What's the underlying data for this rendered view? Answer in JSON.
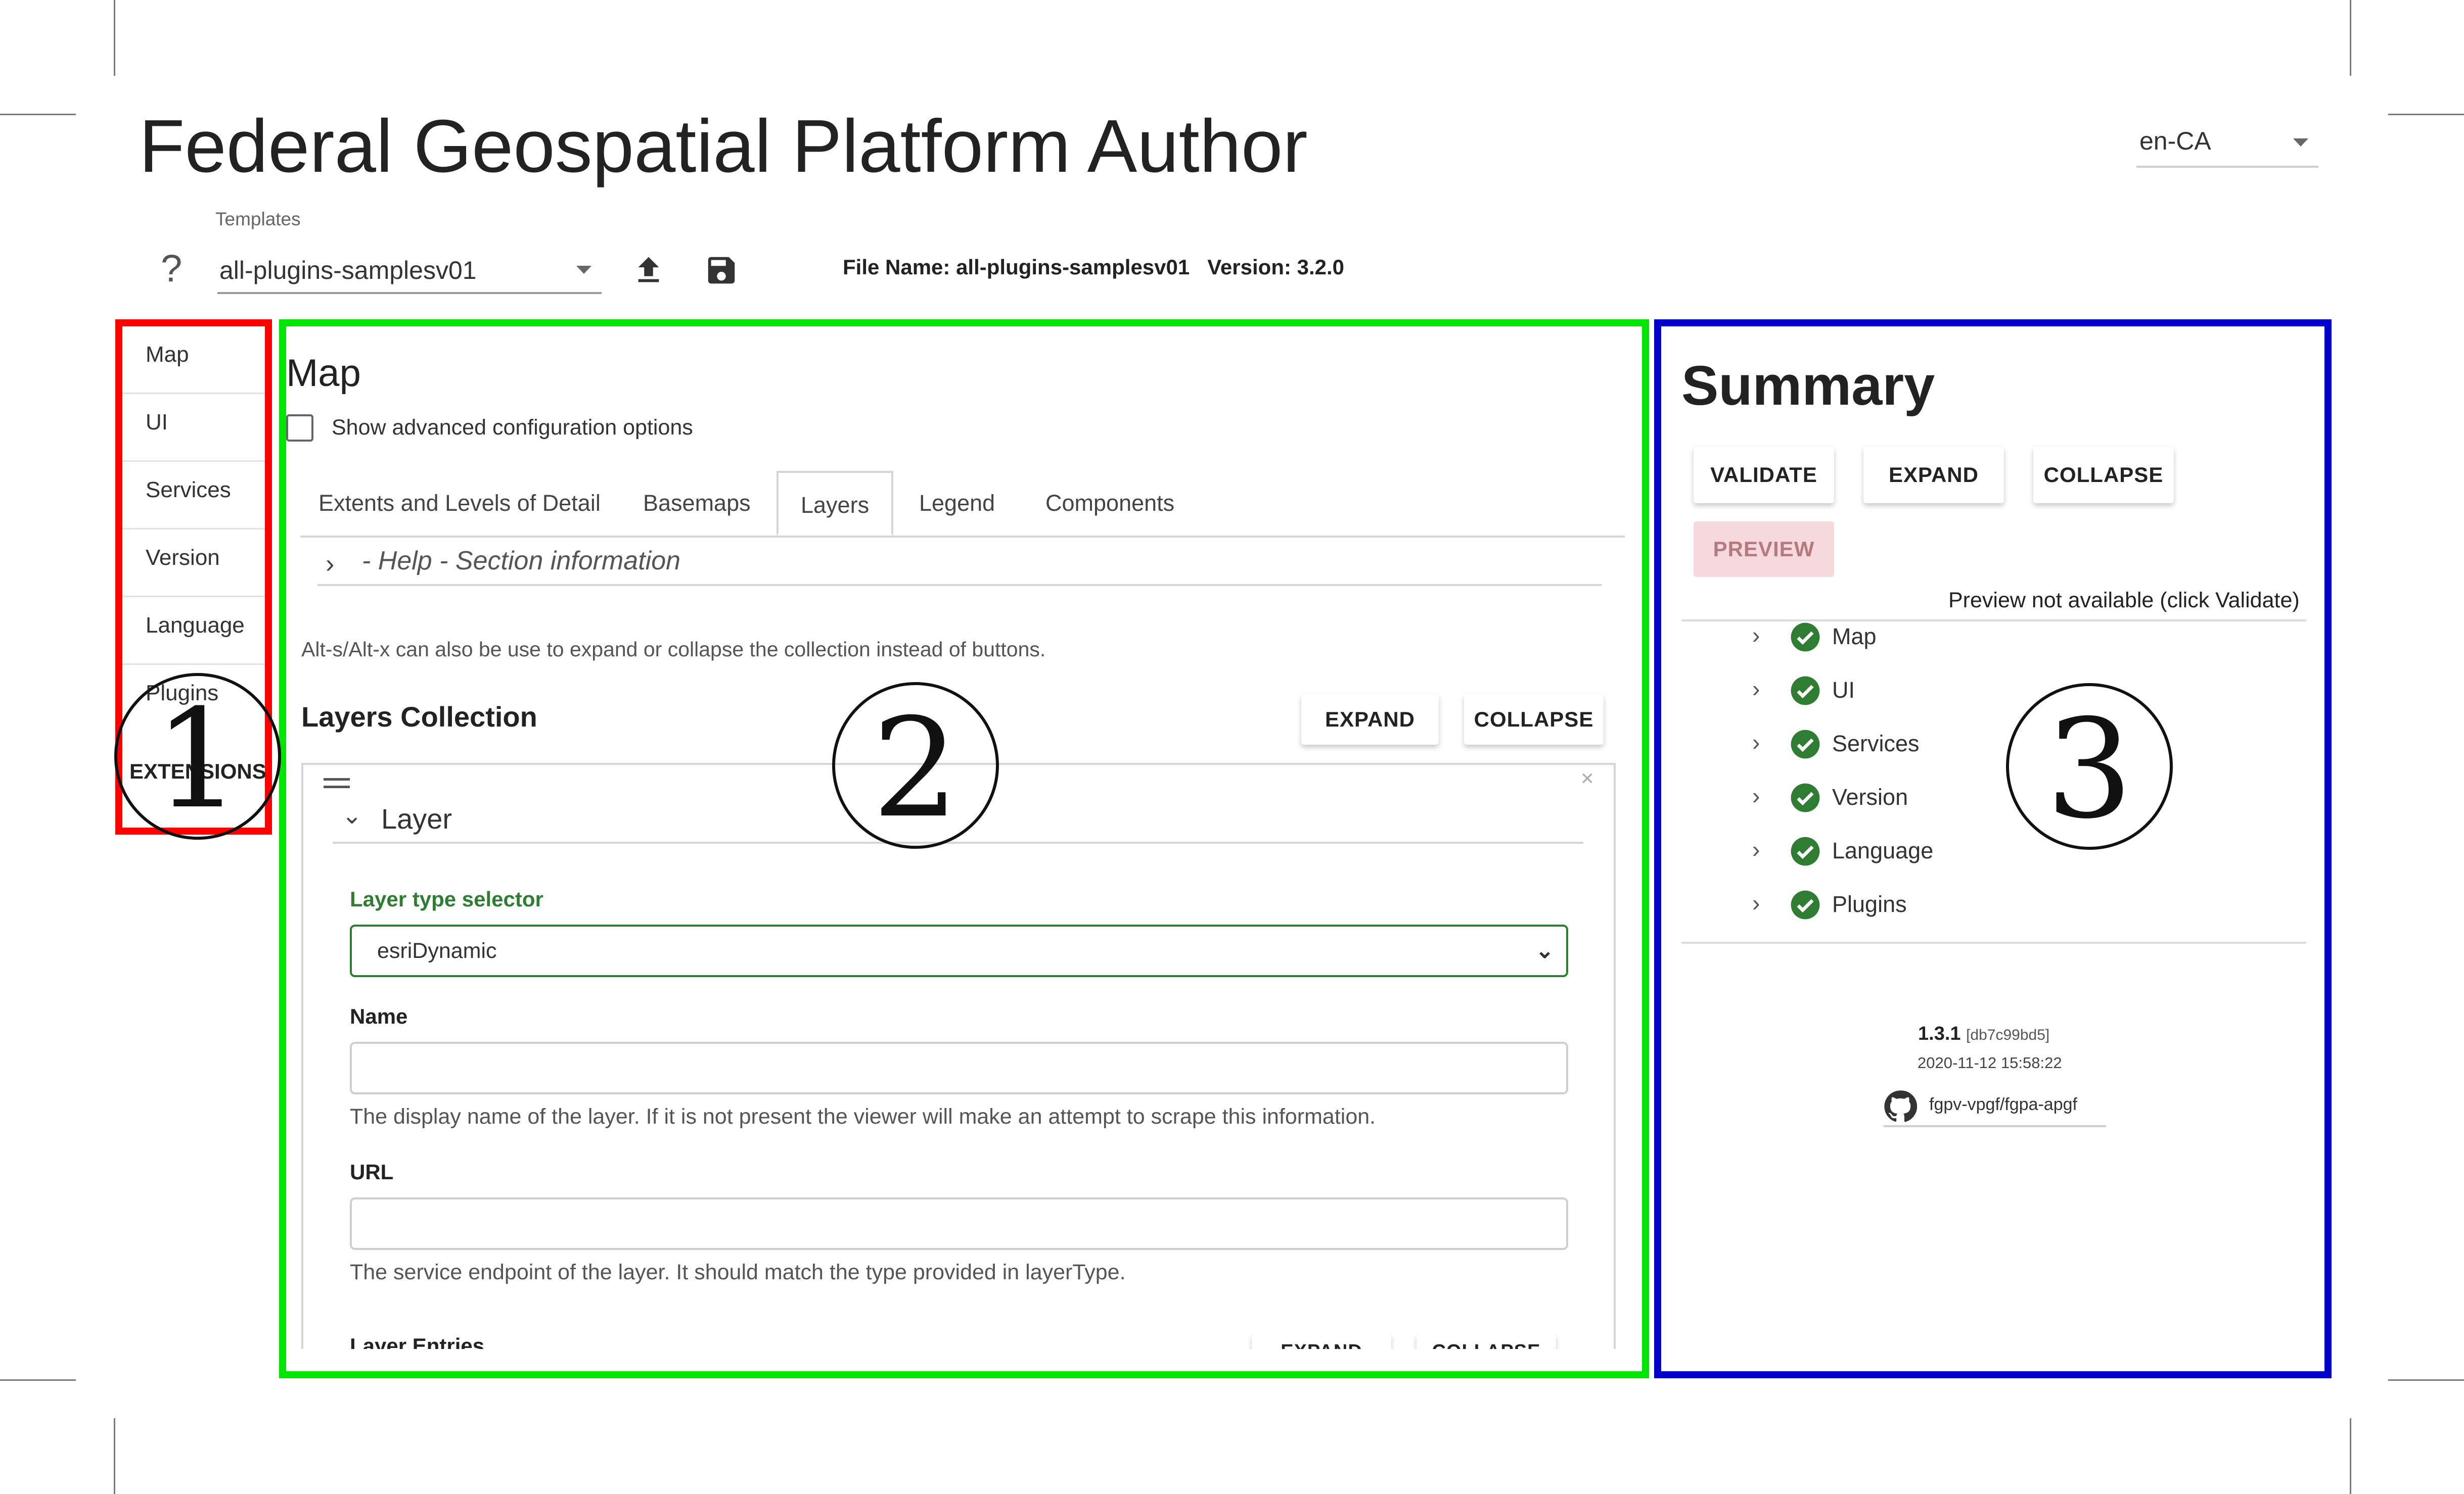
{
  "app_title": "Federal Geospatial Platform Author",
  "language_select": {
    "value": "en-CA"
  },
  "templates": {
    "label": "Templates",
    "value": "all-plugins-samplesv01"
  },
  "toolbar": {
    "help_glyph": "?",
    "upload_icon": "upload-icon",
    "save_icon": "save-icon"
  },
  "file_info": {
    "text": "File Name: all-plugins-samplesv01   Version: 3.2.0"
  },
  "sidebar": {
    "items": [
      {
        "label": "Map"
      },
      {
        "label": "UI"
      },
      {
        "label": "Services"
      },
      {
        "label": "Version"
      },
      {
        "label": "Language"
      },
      {
        "label": "Plugins"
      }
    ],
    "extensions_label": "EXTENSIONS"
  },
  "callouts": {
    "one": "1",
    "two": "2",
    "three": "3"
  },
  "highlight_colors": {
    "one": "#ff0000",
    "two": "#00e600",
    "three": "#0000cc"
  },
  "main": {
    "title": "Map",
    "advanced_checkbox_label": "Show advanced configuration options",
    "tabs": [
      {
        "label": "Extents and Levels of Detail"
      },
      {
        "label": "Basemaps"
      },
      {
        "label": "Layers",
        "active": true
      },
      {
        "label": "Legend"
      },
      {
        "label": "Components"
      }
    ],
    "help_section": "- Help - Section information",
    "collection_note": "Alt-s/Alt-x can also be use to expand or collapse the collection instead of buttons.",
    "layers_collection": {
      "title": "Layers Collection",
      "expand_label": "EXPAND",
      "collapse_label": "COLLAPSE"
    },
    "layer": {
      "header": "Layer",
      "close_glyph": "×",
      "type_selector_label": "Layer type selector",
      "type_value": "esriDynamic",
      "name_label": "Name",
      "name_value": "",
      "name_hint": "The display name of the layer. If it is not present the viewer will make an attempt to scrape this information.",
      "url_label": "URL",
      "url_value": "",
      "url_hint": "The service endpoint of the layer. It should match the type provided in layerType.",
      "entries_label": "Layer Entries",
      "entries_expand": "EXPAND",
      "entries_collapse": "COLLAPSE"
    }
  },
  "summary": {
    "title": "Summary",
    "validate_label": "VALIDATE",
    "expand_label": "EXPAND",
    "collapse_label": "COLLAPSE",
    "preview_label": "PREVIEW",
    "preview_note": "Preview not available (click Validate)",
    "items": [
      {
        "label": "Map"
      },
      {
        "label": "UI"
      },
      {
        "label": "Services"
      },
      {
        "label": "Version"
      },
      {
        "label": "Language"
      },
      {
        "label": "Plugins"
      }
    ],
    "status_color": "#2e7d32",
    "version": "1.3.1",
    "commit": "[db7c99bd5]",
    "build_date": "2020-11-12 15:58:22",
    "repo": "fgpv-vpgf/fgpa-apgf"
  }
}
